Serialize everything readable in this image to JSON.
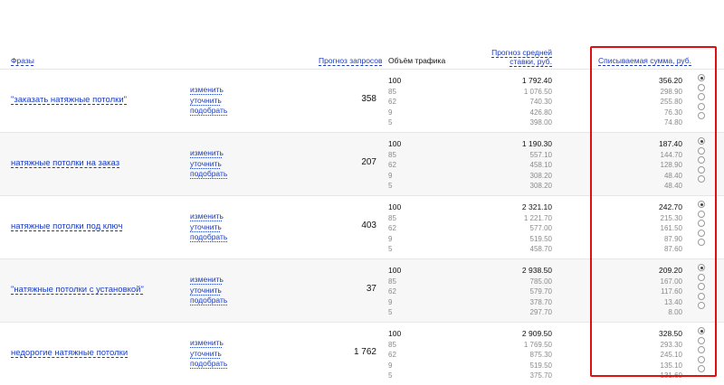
{
  "header": {
    "phrases": "Фразы",
    "forecast_queries": "Прогноз запросов",
    "traffic_volume": "Объём трафика",
    "forecast_bid_line1": "Прогноз средней",
    "forecast_bid_line2": "ставки, руб.",
    "charged_sum": "Списываемая сумма, руб."
  },
  "actions": {
    "change": "изменить",
    "refine": "уточнить",
    "select": "подобрать"
  },
  "highlight_color": "#e01010",
  "link_color": "#1a3dc1",
  "groups": [
    {
      "phrase": "\"заказать натяжные потолки\"",
      "forecast": "358",
      "traffic": [
        "100",
        "85",
        "62",
        "9",
        "5"
      ],
      "bid": [
        "1 792.40",
        "1 076.50",
        "740.30",
        "426.80",
        "398.00"
      ],
      "sum": [
        "356.20",
        "298.90",
        "255.80",
        "76.30",
        "74.80"
      ],
      "selected": 0
    },
    {
      "phrase": "натяжные потолки на заказ",
      "forecast": "207",
      "traffic": [
        "100",
        "85",
        "62",
        "9",
        "5"
      ],
      "bid": [
        "1 190.30",
        "557.10",
        "458.10",
        "308.20",
        "308.20"
      ],
      "sum": [
        "187.40",
        "144.70",
        "128.90",
        "48.40",
        "48.40"
      ],
      "selected": 0
    },
    {
      "phrase": "натяжные потолки под ключ",
      "forecast": "403",
      "traffic": [
        "100",
        "85",
        "62",
        "9",
        "5"
      ],
      "bid": [
        "2 321.10",
        "1 221.70",
        "577.00",
        "519.50",
        "458.70"
      ],
      "sum": [
        "242.70",
        "215.30",
        "161.50",
        "87.90",
        "87.60"
      ],
      "selected": 0
    },
    {
      "phrase": "\"натяжные потолки с установкой\"",
      "forecast": "37",
      "traffic": [
        "100",
        "85",
        "62",
        "9",
        "5"
      ],
      "bid": [
        "2 938.50",
        "785.00",
        "579.70",
        "378.70",
        "297.70"
      ],
      "sum": [
        "209.20",
        "167.00",
        "117.60",
        "13.40",
        "8.00"
      ],
      "selected": 0
    },
    {
      "phrase": "недорогие натяжные потолки",
      "forecast": "1 762",
      "traffic": [
        "100",
        "85",
        "62",
        "9",
        "5"
      ],
      "bid": [
        "2 909.50",
        "1 769.50",
        "875.30",
        "519.50",
        "375.70"
      ],
      "sum": [
        "328.50",
        "293.30",
        "245.10",
        "135.10",
        "131.60"
      ],
      "selected": 0
    }
  ]
}
